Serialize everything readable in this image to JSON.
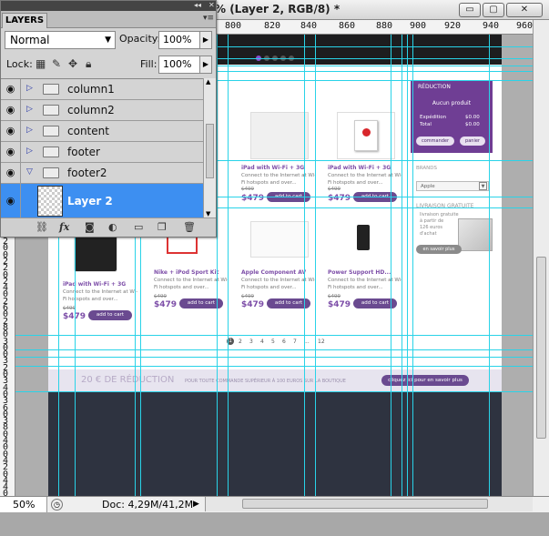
{
  "window": {
    "title": "% (Layer 2, RGB/8) *",
    "buttons": [
      {
        "name": "minimize",
        "glyph": "▭"
      },
      {
        "name": "restore",
        "glyph": "▢"
      },
      {
        "name": "close",
        "glyph": "✕"
      }
    ]
  },
  "ruler": {
    "h_ticks": [
      "800",
      "820",
      "840",
      "860",
      "880",
      "900",
      "920",
      "940",
      "960"
    ],
    "v_ticks": [
      "2",
      "0",
      "0",
      "2",
      "2",
      "0",
      "2",
      "4",
      "0",
      "2",
      "6",
      "0",
      "2",
      "8",
      "0",
      "3",
      "0",
      "0",
      "3",
      "2",
      "0",
      "3",
      "4",
      "0",
      "3",
      "6",
      "0",
      "3",
      "8",
      "0",
      "4",
      "0",
      "0",
      "4",
      "2",
      "0",
      "4",
      "4",
      "0",
      "4",
      "6",
      "0",
      "4",
      "8"
    ]
  },
  "status": {
    "zoom": "50%",
    "doc": "Doc: 4,29M/41,2M"
  },
  "layers_panel": {
    "tab_label": "LAYERS",
    "blend_mode": "Normal",
    "opacity_label": "Opacity:",
    "opacity_value": "100%",
    "lock_label": "Lock:",
    "fill_label": "Fill:",
    "fill_value": "100%",
    "layers": [
      {
        "name": "column1",
        "expanded": false
      },
      {
        "name": "column2",
        "expanded": false
      },
      {
        "name": "content",
        "expanded": false
      },
      {
        "name": "footer",
        "expanded": false
      },
      {
        "name": "footer2",
        "expanded": true
      },
      {
        "name": "Layer 2",
        "selected": true
      }
    ],
    "tools": [
      "link-icon",
      "fx-icon",
      "mask-icon",
      "adjustment-icon",
      "folder-icon",
      "new-layer-icon",
      "trash-icon"
    ]
  },
  "mockup": {
    "cart_box": {
      "title": "RÉDUCTION",
      "empty_text": "Aucun produit",
      "shipping_label": "Expédition",
      "shipping_value": "$0.00",
      "total_label": "Total",
      "total_value": "$0.00",
      "order_btn": "commander",
      "cart_btn": "panier"
    },
    "brands_title": "BRANDS",
    "brand_select": "Apple",
    "free_shipping": {
      "title": "LIVRAISON GRATUITE",
      "line1": "livraison gratuite",
      "line2": "à partir de",
      "line3": "126 euros",
      "line4": "d'achat",
      "btn": "en savoir plus"
    },
    "products_row1": [
      {
        "name": "iPad with Wi-Fi + 3G",
        "desc": "Connect to the Internet at Wi-Fi hotspots and over...",
        "old": "$499",
        "price": "$479",
        "btn": "add to cart"
      },
      {
        "name": "iPad with Wi-Fi + 3G",
        "desc": "Connect to the Internet at Wi-Fi hotspots and over...",
        "old": "$499",
        "price": "$479",
        "btn": "add to cart"
      }
    ],
    "products_row2": [
      {
        "name": "iPad with Wi-Fi + 3G",
        "desc": "Connect to the Internet at Wi-Fi hotspots and over...",
        "old": "$499",
        "price": "$479",
        "btn": "add to cart"
      },
      {
        "name": "Nike + iPod Sport Kit",
        "desc": "Connect to the Internet at Wi-Fi hotspots and over...",
        "old": "$499",
        "price": "$479",
        "btn": "add to cart"
      },
      {
        "name": "Apple Component AV",
        "desc": "Connect to the Internet at Wi-Fi hotspots and over...",
        "old": "$499",
        "price": "$479",
        "btn": "add to cart"
      },
      {
        "name": "Power Support HD...",
        "desc": "Connect to the Internet at Wi-Fi hotspots and over...",
        "old": "$499",
        "price": "$479",
        "btn": "add to cart"
      }
    ],
    "pagination": [
      "1",
      "2",
      "3",
      "4",
      "5",
      "6",
      "7",
      "...",
      "12"
    ],
    "promo": {
      "headline": "20 € DE RÉDUCTION",
      "text": "POUR TOUTE COMMANDE SUPÉRIEUR À 100 EUROS SUR LA BOUTIQUE",
      "btn": "cliquez ici pour en savoir plus"
    }
  }
}
